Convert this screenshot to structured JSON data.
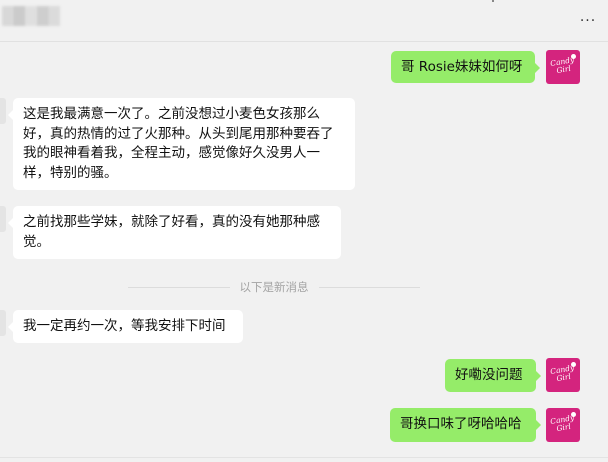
{
  "header": {
    "contact_name": "",
    "more_label": "···"
  },
  "messages": [
    {
      "direction": "out",
      "text": "哥 Rosie妹妹如何呀",
      "avatar": "Candy Girl"
    },
    {
      "direction": "in",
      "text": "这是我最满意一次了。之前没想过小麦色女孩那么好，真的热情的过了火那种。从头到尾用那种要吞了我的眼神看着我，全程主动，感觉像好久没男人一样，特别的骚。"
    },
    {
      "direction": "in",
      "text": "之前找那些学妹，就除了好看，真的没有她那种感觉。"
    },
    {
      "direction": "in",
      "text": "我一定再约一次，等我安排下时间"
    },
    {
      "direction": "out",
      "text": "好嘞没问题",
      "avatar": "Candy Girl"
    },
    {
      "direction": "out",
      "text": "哥换口味了呀哈哈哈",
      "avatar": "Candy Girl"
    }
  ],
  "divider": {
    "label": "以下是新消息"
  },
  "colors": {
    "background": "#f1f1f1",
    "outgoing_bubble": "#95ec69",
    "incoming_bubble": "#ffffff",
    "avatar": "#d4247e"
  },
  "icons": {
    "more": "ellipsis-icon",
    "avatar": "candy-girl-logo"
  }
}
